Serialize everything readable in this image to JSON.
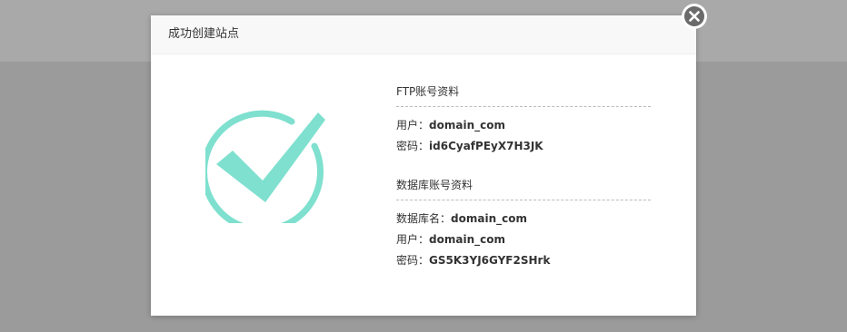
{
  "modal": {
    "title": "成功创建站点"
  },
  "ftp": {
    "heading": "FTP账号资料",
    "user_label": "用户",
    "user_value": "domain_com",
    "password_label": "密码",
    "password_value": "id6CyafPEyX7H3JK"
  },
  "database": {
    "heading": "数据库账号资料",
    "name_label": "数据库名",
    "name_value": "domain_com",
    "user_label": "用户",
    "user_value": "domain_com",
    "password_label": "密码",
    "password_value": "GS5K3YJ6GYF2SHrk"
  },
  "separator": "：",
  "colors": {
    "check": "#7fe0cf",
    "close_button": "#6b6b6b",
    "backdrop": "#9b9b9b"
  },
  "icons": {
    "close": "close-icon",
    "success": "success-check-icon"
  }
}
